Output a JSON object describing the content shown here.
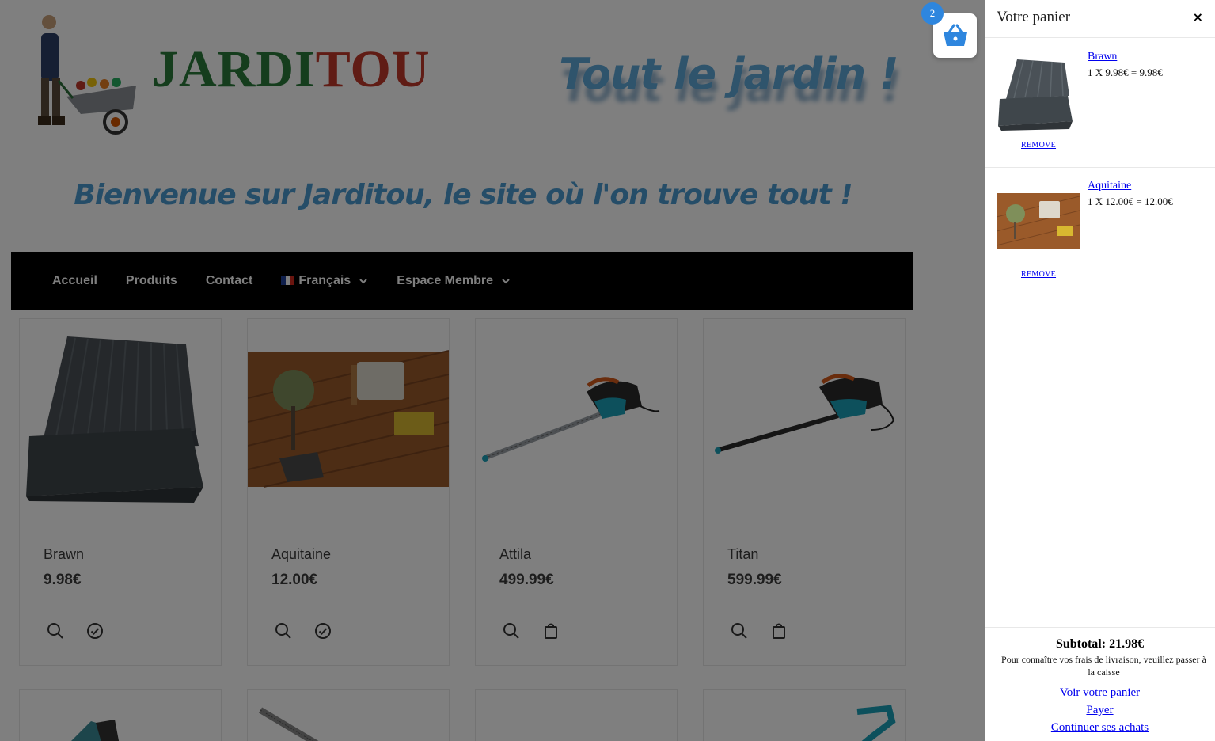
{
  "header": {
    "logo_part1": "JARDI",
    "logo_part2": "TOU",
    "tagline": "Tout le jardin !",
    "welcome": "Bienvenue sur Jarditou, le site où l'on trouve tout !"
  },
  "nav": {
    "items": [
      "Accueil",
      "Produits",
      "Contact",
      "Français",
      "Espace Membre"
    ]
  },
  "products": [
    {
      "name": "Brawn",
      "price": "9.98€",
      "in_cart": true
    },
    {
      "name": "Aquitaine",
      "price": "12.00€",
      "in_cart": true
    },
    {
      "name": "Attila",
      "price": "499.99€",
      "in_cart": false
    },
    {
      "name": "Titan",
      "price": "599.99€",
      "in_cart": false
    }
  ],
  "cart": {
    "count": "2",
    "title": "Votre panier",
    "close": "×",
    "items": [
      {
        "name": "Brawn",
        "line": "1 X 9.98€ = 9.98€",
        "remove": "REMOVE"
      },
      {
        "name": "Aquitaine",
        "line": "1 X 12.00€ = 12.00€",
        "remove": "REMOVE"
      }
    ],
    "subtotal": "Subtotal: 21.98€",
    "shipping_note": "Pour connaître vos frais de livraison, veuillez passer à la caisse",
    "links": [
      "Voir votre panier",
      "Payer",
      "Continuer ses achats"
    ]
  },
  "colors": {
    "accent": "#2e86de",
    "logo_green": "#2a7a3a",
    "logo_red": "#c0392b",
    "nav_bg": "#000000"
  }
}
